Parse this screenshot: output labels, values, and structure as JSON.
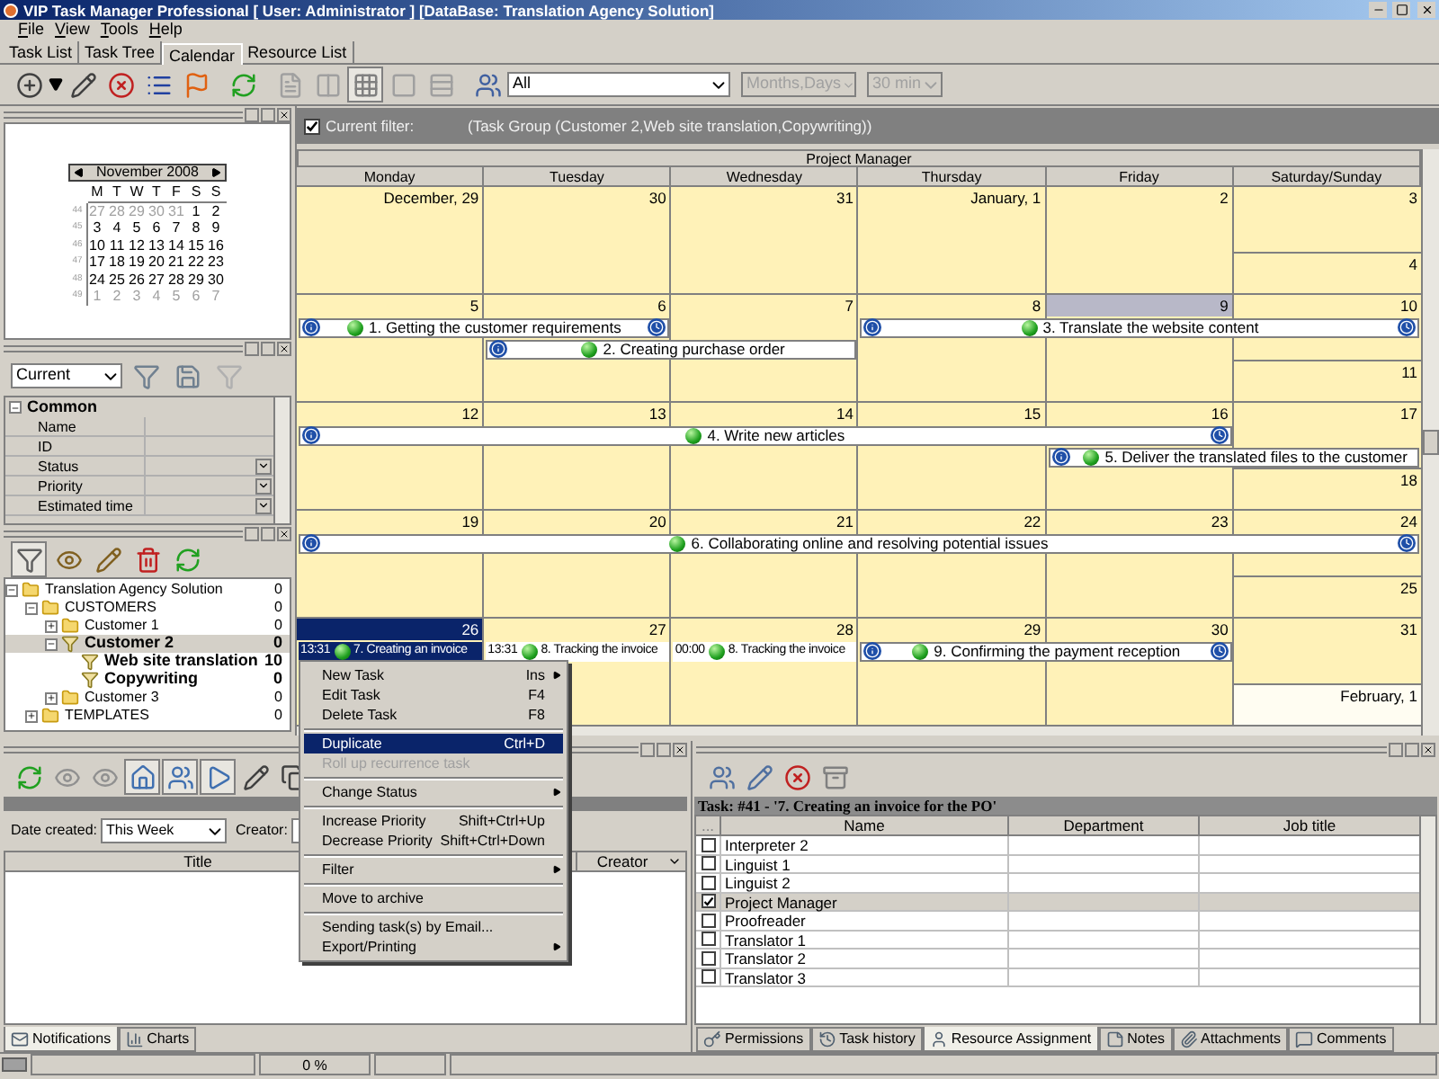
{
  "window": {
    "title": "VIP Task Manager Professional [ User: Administrator ] [DataBase: Translation Agency Solution]"
  },
  "menu": [
    "File",
    "View",
    "Tools",
    "Help"
  ],
  "tabs": [
    {
      "label": "Task List",
      "selected": false
    },
    {
      "label": "Task Tree",
      "selected": false
    },
    {
      "label": "Calendar",
      "selected": true
    },
    {
      "label": "Resource List",
      "selected": false
    }
  ],
  "toolbar": {
    "filter_select": "All",
    "scale_select": {
      "value": "Months,Days",
      "disabled": true
    },
    "interval_select": {
      "value": "30 min",
      "disabled": true
    }
  },
  "mini_calendar": {
    "title": "November 2008",
    "weekdays": [
      "M",
      "T",
      "W",
      "T",
      "F",
      "S",
      "S"
    ],
    "weeks": [
      {
        "number": "44",
        "days": [
          {
            "label": "27",
            "muted": true
          },
          {
            "label": "28",
            "muted": true
          },
          {
            "label": "29",
            "muted": true
          },
          {
            "label": "30",
            "muted": true
          },
          {
            "label": "31",
            "muted": true
          },
          {
            "label": "1",
            "muted": false
          },
          {
            "label": "2",
            "muted": false
          }
        ]
      },
      {
        "number": "45",
        "days": [
          {
            "label": "3",
            "muted": false
          },
          {
            "label": "4",
            "muted": false
          },
          {
            "label": "5",
            "muted": false
          },
          {
            "label": "6",
            "muted": false
          },
          {
            "label": "7",
            "muted": false
          },
          {
            "label": "8",
            "muted": false
          },
          {
            "label": "9",
            "muted": false
          }
        ]
      },
      {
        "number": "46",
        "days": [
          {
            "label": "10",
            "muted": false
          },
          {
            "label": "11",
            "muted": false
          },
          {
            "label": "12",
            "muted": false
          },
          {
            "label": "13",
            "muted": false
          },
          {
            "label": "14",
            "muted": false
          },
          {
            "label": "15",
            "muted": false
          },
          {
            "label": "16",
            "muted": false
          }
        ]
      },
      {
        "number": "47",
        "days": [
          {
            "label": "17",
            "muted": false
          },
          {
            "label": "18",
            "muted": false
          },
          {
            "label": "19",
            "muted": false
          },
          {
            "label": "20",
            "muted": false
          },
          {
            "label": "21",
            "muted": false
          },
          {
            "label": "22",
            "muted": false
          },
          {
            "label": "23",
            "muted": false
          }
        ]
      },
      {
        "number": "48",
        "days": [
          {
            "label": "24",
            "muted": false
          },
          {
            "label": "25",
            "muted": false
          },
          {
            "label": "26",
            "muted": false
          },
          {
            "label": "27",
            "muted": false
          },
          {
            "label": "28",
            "muted": false
          },
          {
            "label": "29",
            "muted": false
          },
          {
            "label": "30",
            "muted": false
          }
        ]
      },
      {
        "number": "49",
        "days": [
          {
            "label": "1",
            "muted": true
          },
          {
            "label": "2",
            "muted": true
          },
          {
            "label": "3",
            "muted": true
          },
          {
            "label": "4",
            "muted": true
          },
          {
            "label": "5",
            "muted": true
          },
          {
            "label": "6",
            "muted": true
          },
          {
            "label": "7",
            "muted": true
          }
        ]
      }
    ]
  },
  "filter_panel": {
    "select": "Current",
    "grid": {
      "category": "Common",
      "expanded": true,
      "rows": [
        {
          "label": "Name",
          "dropdown": false
        },
        {
          "label": "ID",
          "dropdown": false
        },
        {
          "label": "Status",
          "dropdown": true
        },
        {
          "label": "Priority",
          "dropdown": true
        },
        {
          "label": "Estimated time",
          "dropdown": true
        }
      ]
    }
  },
  "tree": [
    {
      "label": "Translation Agency Solution",
      "count": "0",
      "kind": "folder",
      "bold": false,
      "selected": false,
      "expanded": true,
      "children": [
        {
          "label": "CUSTOMERS",
          "count": "0",
          "kind": "folder",
          "bold": false,
          "selected": false,
          "expanded": true,
          "children": [
            {
              "label": "Customer 1",
              "count": "0",
              "kind": "folder",
              "bold": false,
              "selected": false,
              "expanded": false
            },
            {
              "label": "Customer 2",
              "count": "0",
              "kind": "filter",
              "bold": true,
              "selected": true,
              "expanded": true,
              "children": [
                {
                  "label": "Web site translation",
                  "count": "10",
                  "kind": "filter",
                  "bold": true,
                  "selected": false
                },
                {
                  "label": "Copywriting",
                  "count": "0",
                  "kind": "filter",
                  "bold": true,
                  "selected": false
                }
              ]
            },
            {
              "label": "Customer 3",
              "count": "0",
              "kind": "folder",
              "bold": false,
              "selected": false,
              "expanded": false
            }
          ]
        },
        {
          "label": "TEMPLATES",
          "count": "0",
          "kind": "folder",
          "bold": false,
          "selected": false,
          "expanded": false
        }
      ]
    }
  ],
  "calendar": {
    "filter": {
      "checked": true,
      "label": "Current filter:",
      "text": "(Task Group  (Customer 2,Web site translation,Copywriting))"
    },
    "title": "Project Manager",
    "columns": [
      "Monday",
      "Tuesday",
      "Wednesday",
      "Thursday",
      "Friday",
      "Saturday/Sunday"
    ],
    "weeks": [
      {
        "days": [
          {
            "label": "December, 29",
            "selected": false,
            "today": false,
            "muted": false
          },
          {
            "label": "30",
            "selected": false,
            "today": false,
            "muted": false
          },
          {
            "label": "31",
            "selected": false,
            "today": false,
            "muted": false
          },
          {
            "label": "January, 1",
            "selected": false,
            "today": false,
            "muted": false
          },
          {
            "label": "2",
            "selected": false,
            "today": false,
            "muted": false
          },
          {
            "label": "3",
            "selected": false,
            "today": false,
            "muted": false
          },
          {
            "label": "4",
            "selected": false,
            "today": false,
            "muted": false
          }
        ]
      },
      {
        "days": [
          {
            "label": "5",
            "selected": false,
            "today": false,
            "muted": false
          },
          {
            "label": "6",
            "selected": false,
            "today": false,
            "muted": false
          },
          {
            "label": "7",
            "selected": false,
            "today": false,
            "muted": false
          },
          {
            "label": "8",
            "selected": false,
            "today": false,
            "muted": false
          },
          {
            "label": "9",
            "selected": false,
            "today": true,
            "muted": false
          },
          {
            "label": "10",
            "selected": false,
            "today": false,
            "muted": false
          },
          {
            "label": "11",
            "selected": false,
            "today": false,
            "muted": false
          }
        ],
        "lanes": [
          [
            {
              "kind": "event",
              "title": "1. Getting the customer requirements",
              "start_marker": true,
              "end_marker": true,
              "selected": false
            },
            {
              "kind": "continued"
            },
            {
              "kind": "empty"
            },
            {
              "kind": "event",
              "title": "3. Translate the website content",
              "start_marker": true,
              "end_marker": true,
              "selected": false
            },
            {
              "kind": "continued"
            },
            {
              "kind": "continued"
            }
          ],
          [
            {
              "kind": "empty"
            },
            {
              "kind": "event",
              "title": "2. Creating purchase order",
              "start_marker": true,
              "end_marker": false,
              "selected": false
            },
            {
              "kind": "continued"
            },
            {
              "kind": "empty"
            },
            {
              "kind": "empty"
            },
            {
              "kind": "empty"
            }
          ]
        ]
      },
      {
        "days": [
          {
            "label": "12",
            "selected": false,
            "today": false,
            "muted": false
          },
          {
            "label": "13",
            "selected": false,
            "today": false,
            "muted": false
          },
          {
            "label": "14",
            "selected": false,
            "today": false,
            "muted": false
          },
          {
            "label": "15",
            "selected": false,
            "today": false,
            "muted": false
          },
          {
            "label": "16",
            "selected": false,
            "today": false,
            "muted": false
          },
          {
            "label": "17",
            "selected": false,
            "today": false,
            "muted": false
          },
          {
            "label": "18",
            "selected": false,
            "today": false,
            "muted": false
          }
        ],
        "lanes": [
          [
            {
              "kind": "event",
              "title": "4. Write new articles",
              "start_marker": true,
              "end_marker": true,
              "selected": false
            },
            {
              "kind": "continued"
            },
            {
              "kind": "continued"
            },
            {
              "kind": "continued"
            },
            {
              "kind": "continued"
            },
            {
              "kind": "empty"
            }
          ],
          [
            {
              "kind": "empty"
            },
            {
              "kind": "empty"
            },
            {
              "kind": "empty"
            },
            {
              "kind": "empty"
            },
            {
              "kind": "event",
              "title": "5. Deliver the translated files to the customer",
              "start_marker": true,
              "end_marker": false,
              "selected": false
            },
            {
              "kind": "continued"
            }
          ]
        ]
      },
      {
        "days": [
          {
            "label": "19",
            "selected": false,
            "today": false,
            "muted": false
          },
          {
            "label": "20",
            "selected": false,
            "today": false,
            "muted": false
          },
          {
            "label": "21",
            "selected": false,
            "today": false,
            "muted": false
          },
          {
            "label": "22",
            "selected": false,
            "today": false,
            "muted": false
          },
          {
            "label": "23",
            "selected": false,
            "today": false,
            "muted": false
          },
          {
            "label": "24",
            "selected": false,
            "today": false,
            "muted": false
          },
          {
            "label": "25",
            "selected": false,
            "today": false,
            "muted": false
          }
        ],
        "lanes": [
          [
            {
              "kind": "event",
              "title": "6. Collaborating online and resolving potential issues",
              "start_marker": true,
              "end_marker": true,
              "selected": false
            },
            {
              "kind": "continued"
            },
            {
              "kind": "continued"
            },
            {
              "kind": "continued"
            },
            {
              "kind": "continued"
            },
            {
              "kind": "continued"
            }
          ]
        ]
      },
      {
        "days": [
          {
            "label": "26",
            "selected": true,
            "today": false,
            "muted": false
          },
          {
            "label": "27",
            "selected": false,
            "today": false,
            "muted": false
          },
          {
            "label": "28",
            "selected": false,
            "today": false,
            "muted": false
          },
          {
            "label": "29",
            "selected": false,
            "today": false,
            "muted": false
          },
          {
            "label": "30",
            "selected": false,
            "today": false,
            "muted": false
          },
          {
            "label": "31",
            "selected": false,
            "today": false,
            "muted": false
          },
          {
            "label": "February, 1",
            "selected": false,
            "today": false,
            "muted": true
          }
        ],
        "lanes": [
          [
            {
              "kind": "event",
              "time": "13:31",
              "title": "7. Creating an invoice",
              "start_marker": false,
              "end_marker": false,
              "selected": true
            },
            {
              "kind": "event",
              "time": "13:31",
              "title": "8. Tracking the invoice",
              "start_marker": false,
              "end_marker": false,
              "selected": false
            },
            {
              "kind": "event",
              "time": "00:00",
              "title": "8. Tracking the invoice",
              "start_marker": false,
              "end_marker": false,
              "selected": false
            },
            {
              "kind": "event",
              "title": "9. Confirming the payment reception",
              "start_marker": true,
              "end_marker": true,
              "selected": false
            },
            {
              "kind": "continued"
            },
            {
              "kind": "empty"
            }
          ]
        ]
      }
    ]
  },
  "context_menu": [
    {
      "kind": "item",
      "label": "New Task",
      "shortcut": "Ins",
      "submenu": true,
      "selected": false,
      "disabled": false
    },
    {
      "kind": "item",
      "label": "Edit Task",
      "shortcut": "F4",
      "submenu": false,
      "selected": false,
      "disabled": false
    },
    {
      "kind": "item",
      "label": "Delete Task",
      "shortcut": "F8",
      "submenu": false,
      "selected": false,
      "disabled": false
    },
    {
      "kind": "separator"
    },
    {
      "kind": "item",
      "label": "Duplicate",
      "shortcut": "Ctrl+D",
      "submenu": false,
      "selected": true,
      "disabled": false
    },
    {
      "kind": "item",
      "label": "Roll up recurrence task",
      "submenu": false,
      "selected": false,
      "disabled": true
    },
    {
      "kind": "separator"
    },
    {
      "kind": "item",
      "label": "Change Status",
      "submenu": true,
      "selected": false,
      "disabled": false
    },
    {
      "kind": "separator"
    },
    {
      "kind": "item",
      "label": "Increase Priority",
      "shortcut": "Shift+Ctrl+Up",
      "submenu": false,
      "selected": false,
      "disabled": false
    },
    {
      "kind": "item",
      "label": "Decrease Priority",
      "shortcut": "Shift+Ctrl+Down",
      "submenu": false,
      "selected": false,
      "disabled": false
    },
    {
      "kind": "separator"
    },
    {
      "kind": "item",
      "label": "Filter",
      "submenu": true,
      "selected": false,
      "disabled": false
    },
    {
      "kind": "separator"
    },
    {
      "kind": "item",
      "label": "Move to archive",
      "submenu": false,
      "selected": false,
      "disabled": false
    },
    {
      "kind": "separator"
    },
    {
      "kind": "item",
      "label": "Sending task(s) by Email...",
      "submenu": false,
      "selected": false,
      "disabled": false
    },
    {
      "kind": "item",
      "label": "Export/Printing",
      "submenu": true,
      "selected": false,
      "disabled": false
    }
  ],
  "notifications": {
    "date_label": "Date created:",
    "date_value": "This Week",
    "creator_label": "Creator:",
    "columns": [
      "Title",
      "Creator"
    ],
    "tabs": [
      {
        "label": "Notifications",
        "selected": true
      },
      {
        "label": "Charts",
        "selected": false
      }
    ]
  },
  "resources": {
    "title": "Task: #41 - '7. Creating an invoice for the PO'",
    "columns": [
      "...",
      "Name",
      "Department",
      "Job title"
    ],
    "rows": [
      {
        "name": "Interpreter 2",
        "checked": false,
        "selected": false
      },
      {
        "name": "Linguist 1",
        "checked": false,
        "selected": false
      },
      {
        "name": "Linguist 2",
        "checked": false,
        "selected": false
      },
      {
        "name": "Project Manager",
        "checked": true,
        "selected": true
      },
      {
        "name": "Proofreader",
        "checked": false,
        "selected": false
      },
      {
        "name": "Translator 1",
        "checked": false,
        "selected": false
      },
      {
        "name": "Translator 2",
        "checked": false,
        "selected": false
      },
      {
        "name": "Translator 3",
        "checked": false,
        "selected": false
      }
    ],
    "tabs": [
      {
        "label": "Permissions",
        "selected": false
      },
      {
        "label": "Task history",
        "selected": false
      },
      {
        "label": "Resource Assignment",
        "selected": true
      },
      {
        "label": "Notes",
        "selected": false
      },
      {
        "label": "Attachments",
        "selected": false
      },
      {
        "label": "Comments",
        "selected": false
      }
    ]
  },
  "status_bar": {
    "progress": "0 %"
  }
}
